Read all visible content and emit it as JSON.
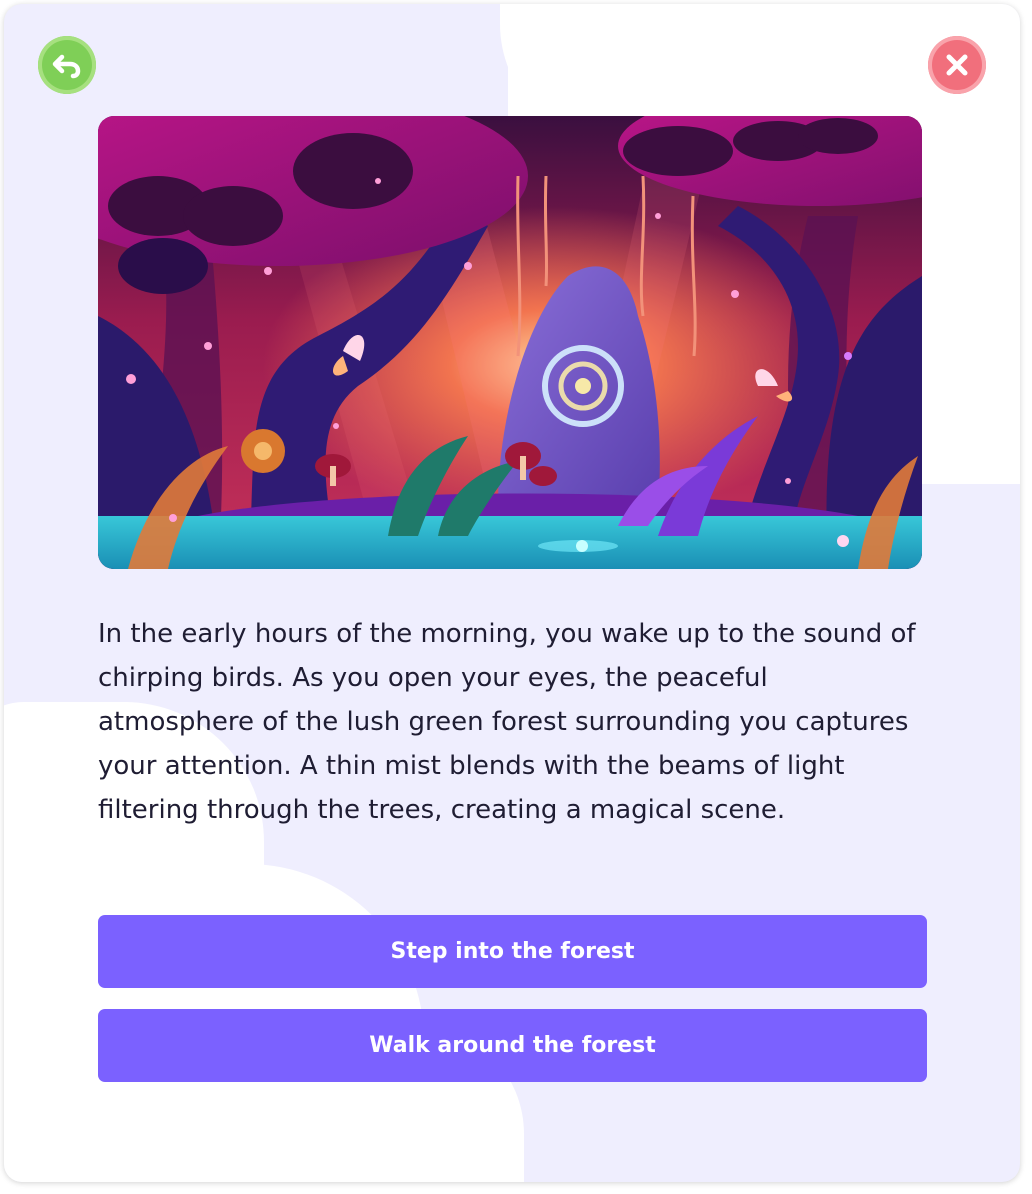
{
  "navigation": {
    "back_icon": "undo-arrow-icon",
    "close_icon": "close-x-icon"
  },
  "scene_image": {
    "subject": "enchanted-forest-illustration"
  },
  "story": {
    "text": "In the early hours of the morning, you wake up to the sound of chirping birds. As you open your eyes, the peaceful atmosphere of the lush green forest surrounding you captures your attention. A thin mist blends with the beams of light filtering through the trees, creating a magical scene."
  },
  "choices": [
    {
      "label": "Step into the forest"
    },
    {
      "label": "Walk around the forest"
    }
  ],
  "colors": {
    "background": "#efeefe",
    "accent": "#7b61ff",
    "back_button": "#7fcf57",
    "close_button": "#f16f7c",
    "text": "#1f1d33"
  }
}
